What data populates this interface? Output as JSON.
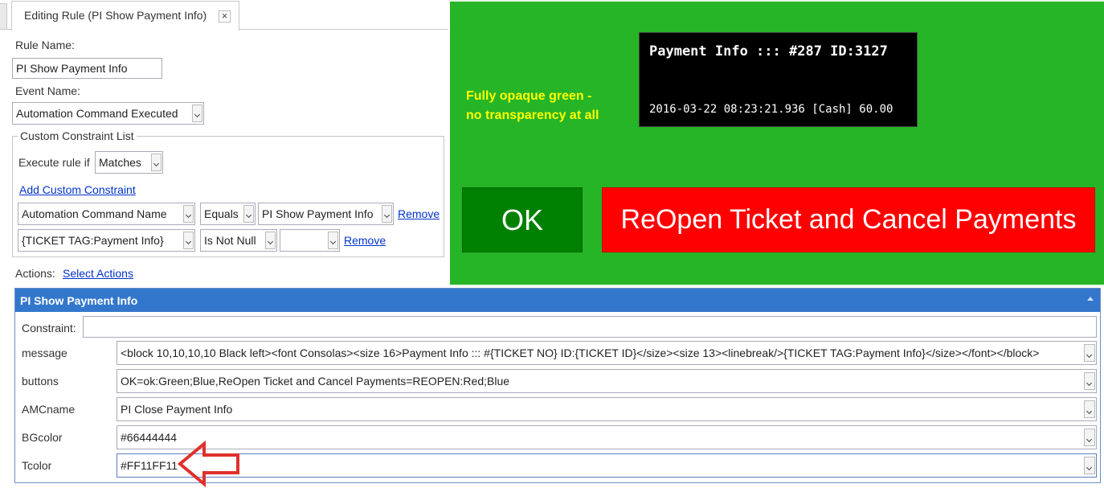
{
  "tab": {
    "title": "Editing Rule (PI Show Payment Info)",
    "close": "×"
  },
  "rule_name": {
    "label": "Rule Name:",
    "value": "PI Show Payment Info"
  },
  "event_name": {
    "label": "Event Name:",
    "value": "Automation Command Executed"
  },
  "constraint_list": {
    "title": "Custom Constraint List",
    "execute_label": "Execute rule if",
    "execute_value": "Matches",
    "add_link": "Add Custom Constraint",
    "rows": [
      {
        "field": "Automation Command Name",
        "op": "Equals",
        "value": "PI Show Payment Info",
        "remove": "Remove"
      },
      {
        "field": "{TICKET TAG:Payment Info}",
        "op": "Is Not Null",
        "value": "",
        "remove": "Remove"
      }
    ]
  },
  "actions": {
    "label": "Actions:",
    "link": "Select Actions"
  },
  "action_panel": {
    "title": "PI Show Payment Info",
    "constraint_label": "Constraint:",
    "constraint_value": "",
    "params": [
      {
        "name": "message",
        "value": "<block 10,10,10,10 Black left><font Consolas><size 16>Payment Info ::: #{TICKET NO} ID:{TICKET ID}</size><size 13><linebreak/>{TICKET TAG:Payment Info}</size></font></block>"
      },
      {
        "name": "buttons",
        "value": "OK=ok:Green;Blue,ReOpen Ticket and Cancel Payments=REOPEN:Red;Blue"
      },
      {
        "name": "AMCname",
        "value": "PI Close Payment Info"
      },
      {
        "name": "BGcolor",
        "value": "#66444444"
      },
      {
        "name": "Tcolor",
        "value": "#FF11FF11"
      }
    ]
  },
  "preview": {
    "bg_color": "#26b526",
    "annotation": "Fully opaque green -\nno transparency at all",
    "annotation_color": "#ffff00",
    "payment_title": "Payment Info ::: #287 ID:3127",
    "payment_detail": "2016-03-22 08:23:21.936 [Cash] 60.00",
    "ok_button": "OK",
    "ok_color": "#008000",
    "reopen_button": "ReOpen Ticket and Cancel Payments",
    "reopen_color": "#ff0000"
  },
  "arrow_color": "#e0302c"
}
